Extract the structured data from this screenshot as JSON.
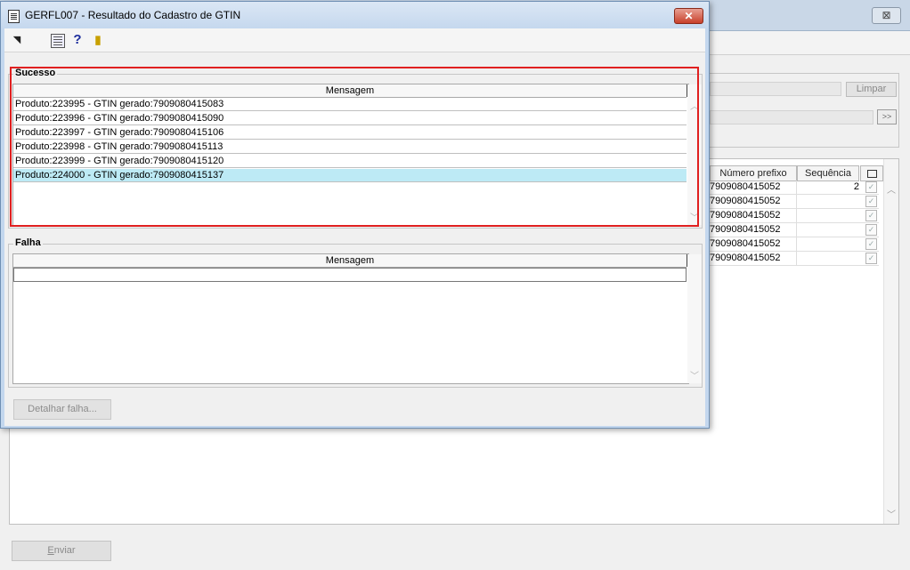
{
  "background_window": {
    "close_label": "⊠",
    "limpar_label": "Limpar",
    "more_label": ">>",
    "grid": {
      "columns": [
        "Número prefixo",
        "Sequência",
        ""
      ],
      "rows": [
        {
          "prefix": "7909080415052",
          "seq": "2",
          "checked": true
        },
        {
          "prefix": "7909080415052",
          "seq": "",
          "checked": true
        },
        {
          "prefix": "7909080415052",
          "seq": "",
          "checked": true
        },
        {
          "prefix": "7909080415052",
          "seq": "",
          "checked": true
        },
        {
          "prefix": "7909080415052",
          "seq": "",
          "checked": true
        },
        {
          "prefix": "7909080415052",
          "seq": "",
          "checked": true
        }
      ]
    },
    "enviar_label": "Enviar"
  },
  "dialog": {
    "title": "GERFL007 - Resultado do Cadastro de GTIN",
    "close_label": "✕",
    "toolbar": {
      "icons": [
        "arrow-icon",
        "calculator-icon",
        "help-icon",
        "exit-icon"
      ],
      "help_glyph": "?",
      "arrow_glyph": "◥",
      "exit_glyph": "▮"
    },
    "success_group": {
      "label": "Sucesso",
      "column": "Mensagem",
      "rows": [
        "Produto:223995 - GTIN gerado:7909080415083",
        "Produto:223996 - GTIN gerado:7909080415090",
        "Produto:223997 - GTIN gerado:7909080415106",
        "Produto:223998 - GTIN gerado:7909080415113",
        "Produto:223999 - GTIN gerado:7909080415120",
        "Produto:224000 - GTIN gerado:7909080415137"
      ],
      "selected_index": 5
    },
    "failure_group": {
      "label": "Falha",
      "column": "Mensagem",
      "rows": [
        ""
      ]
    },
    "detail_button_label": "Detalhar falha...",
    "highlight_color": "#e02020"
  }
}
